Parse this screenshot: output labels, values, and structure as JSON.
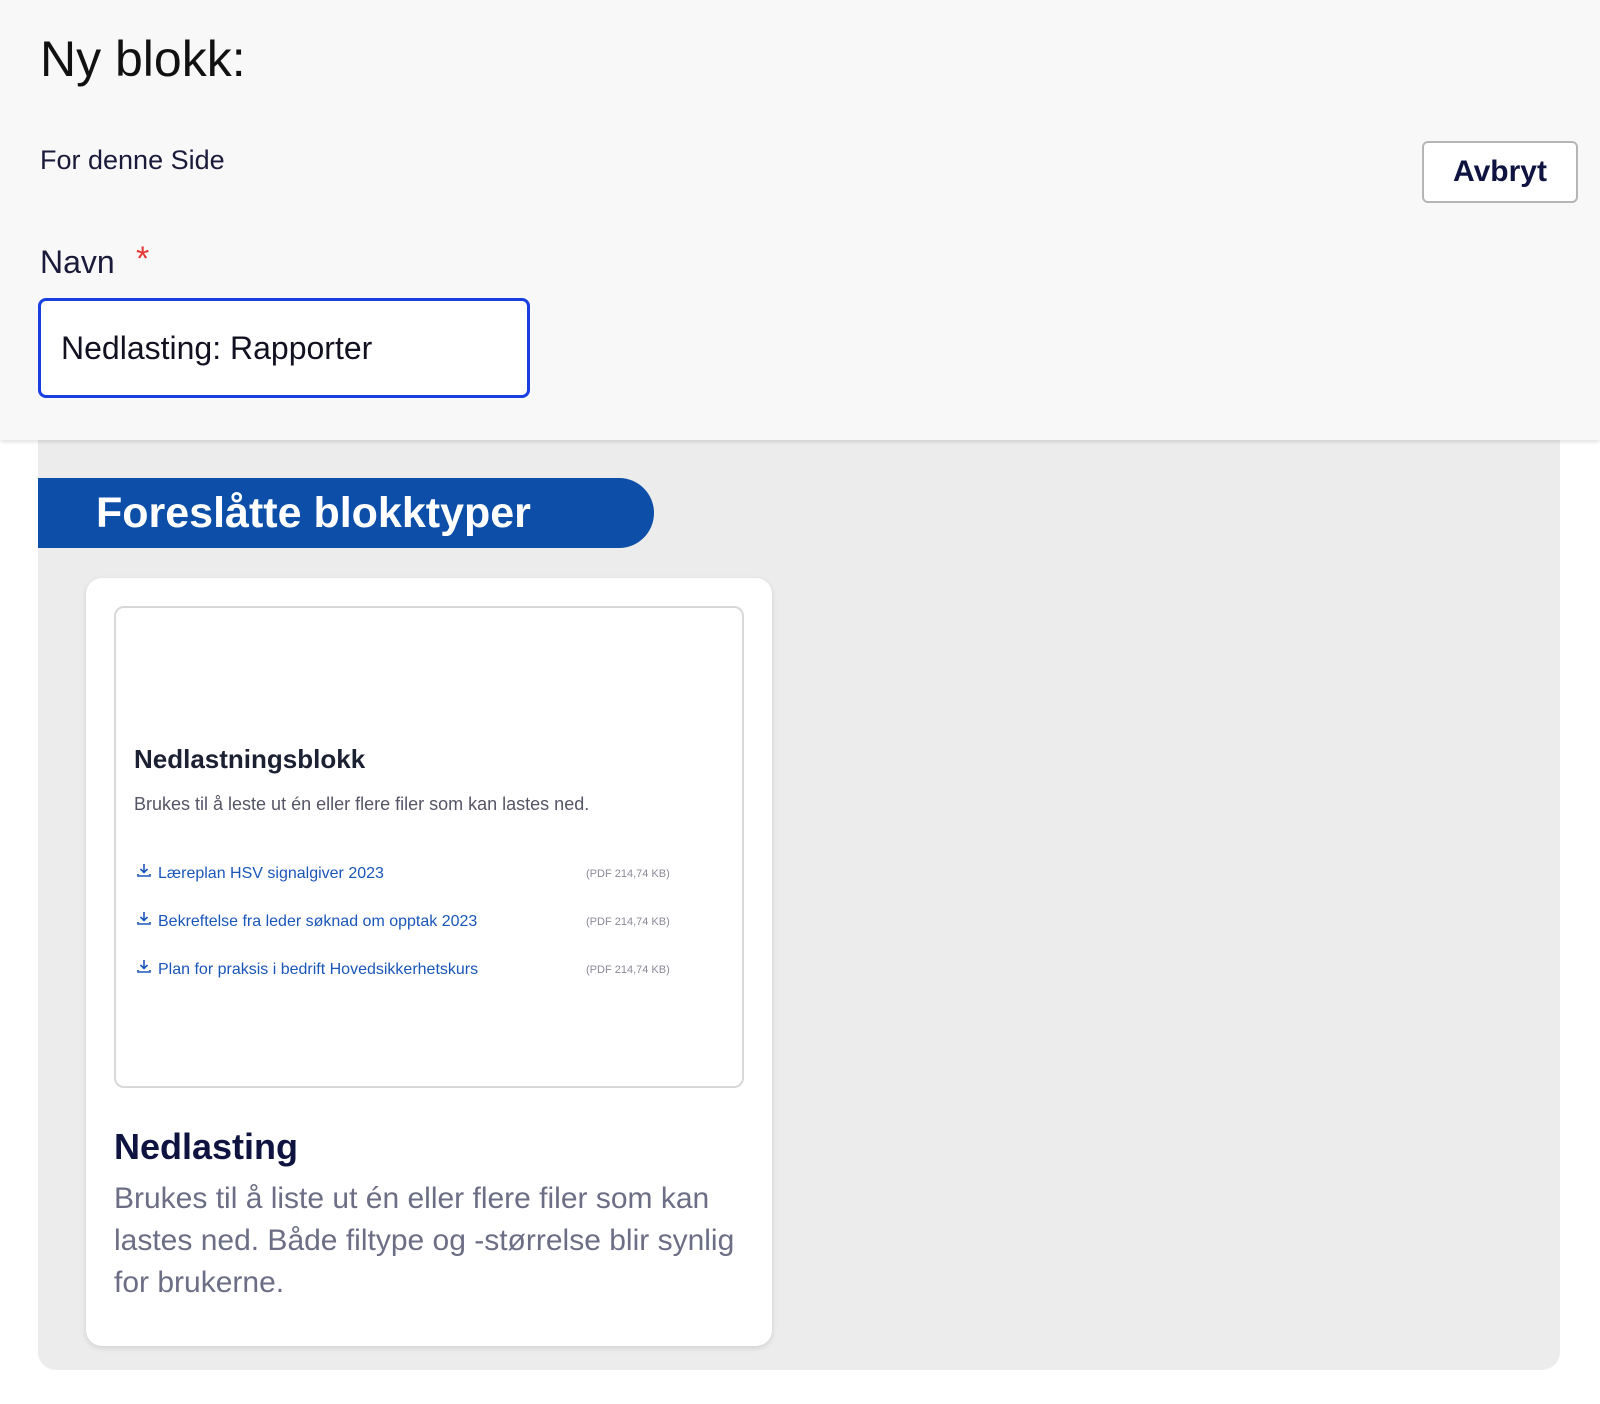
{
  "dialog": {
    "title": "Ny blokk:",
    "context": "For denne Side",
    "cancel_label": "Avbryt"
  },
  "name_field": {
    "label": "Navn",
    "required_mark": "*",
    "value": "Nedlasting: Rapporter"
  },
  "suggested": {
    "heading": "Foreslåtte blokktyper",
    "cards": [
      {
        "title": "Nedlasting",
        "description": "Brukes til å liste ut én eller flere filer som kan lastes ned. Både filtype og -størrelse blir synlig for brukerne.",
        "preview": {
          "title": "Nedlastningsblokk",
          "description": "Brukes til å leste ut én eller flere filer som kan lastes ned.",
          "files": [
            {
              "name": "Læreplan HSV signalgiver 2023",
              "meta": "(PDF 214,74 KB)"
            },
            {
              "name": "Bekreftelse fra leder søknad om opptak 2023",
              "meta": "(PDF 214,74 KB)"
            },
            {
              "name": "Plan for praksis i bedrift Hovedsikkerhetskurs",
              "meta": "(PDF 214,74 KB)"
            }
          ]
        }
      }
    ]
  },
  "colors": {
    "accent_blue": "#0c4ea8",
    "input_focus": "#1a3fe0",
    "required": "#e53935"
  }
}
